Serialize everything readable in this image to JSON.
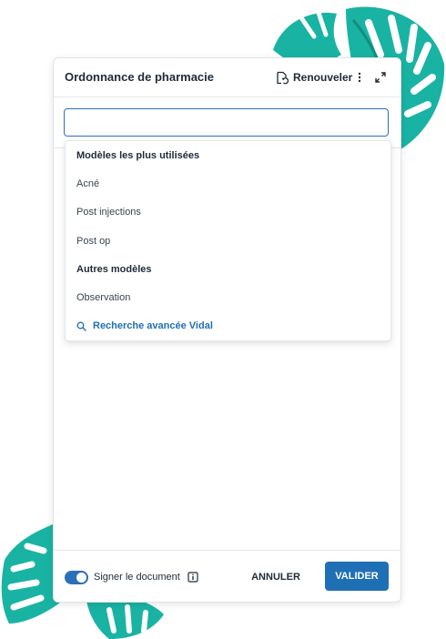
{
  "colors": {
    "leaf": "#19b3a3",
    "leaf_dark": "#128d80",
    "accent": "#1f6fb5"
  },
  "panel": {
    "title": "Ordonnance de pharmacie",
    "renew_label": "Renouveler",
    "icons": [
      "renew-icon",
      "more-vert-icon",
      "expand-icon"
    ]
  },
  "search": {
    "value": "",
    "placeholder": ""
  },
  "dropdown": {
    "section_most_used": "Modèles les plus utilisées",
    "most_used_items": [
      "Acné",
      "Post injections",
      "Post op"
    ],
    "section_other": "Autres modèles",
    "other_items": [
      "Observation"
    ],
    "advanced_search": "Recherche avancée Vidal"
  },
  "footer": {
    "sign_label": "Signer le document",
    "sign_enabled": true,
    "cancel_label": "ANNULER",
    "validate_label": "VALIDER"
  }
}
